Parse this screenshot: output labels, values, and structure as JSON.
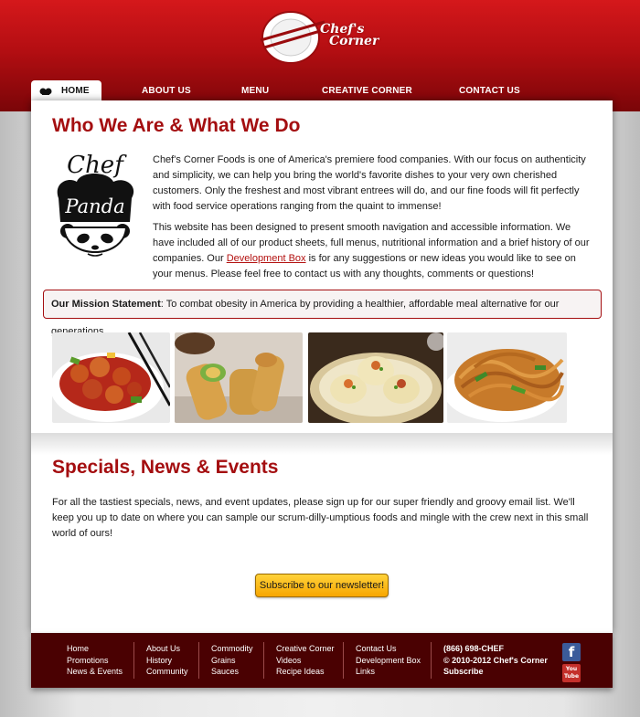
{
  "logo": {
    "line1": "Chef's",
    "line2": "Corner"
  },
  "nav": {
    "items": [
      {
        "label": "HOME",
        "active": true
      },
      {
        "label": "ABOUT US"
      },
      {
        "label": "MENU"
      },
      {
        "label": "CREATIVE CORNER"
      },
      {
        "label": "CONTACT US"
      }
    ]
  },
  "intro": {
    "title": "Who We Are & What We Do",
    "panda_line1": "Chef",
    "panda_line2": "Panda",
    "p1": "Chef's Corner Foods is one of America's premiere food companies. With our focus on authenticity and simplicity, we can help you bring the world's favorite dishes to your very own cherished customers. Only the freshest and most vibrant entrees will do, and our fine foods will fit perfectly with food service operations ranging from the quaint to immense!",
    "p2_before": "This website has been designed to present smooth navigation and accessible information. We have included all of our product sheets, full menus, nutritional information and a brief history of our companies. Our ",
    "p2_link": "Development Box",
    "p2_after": " is for any suggestions or new ideas you would like to see on your menus. Please feel free to contact us with any thoughts, comments or questions!"
  },
  "mission": {
    "label": "Our Mission Statement",
    "text": ": To combat obesity in America by providing a healthier, affordable meal alternative for our generations."
  },
  "photos": [
    {
      "name": "sweet-and-sour-chicken"
    },
    {
      "name": "spring-rolls"
    },
    {
      "name": "dumplings"
    },
    {
      "name": "lo-mein-noodles"
    }
  ],
  "news": {
    "title": "Specials, News & Events",
    "text": "For all the tastiest specials, news, and event updates, please sign up for our super friendly and groovy email list. We'll keep you up to date on where you can sample our scrum-dilly-umptious foods and mingle with the crew next in this small world of ours!",
    "button": "Subscribe to our newsletter!"
  },
  "footer": {
    "col1": [
      "Home",
      "Promotions",
      "News & Events"
    ],
    "col2": [
      "About Us",
      "History",
      "Community"
    ],
    "col3": [
      "Commodity",
      "Grains",
      "Sauces"
    ],
    "col4": [
      "Creative Corner",
      "Videos",
      "Recipe Ideas"
    ],
    "col5": [
      "Contact Us",
      "Development Box",
      "Links"
    ],
    "phone": "(866) 698-CHEF",
    "copyright": "© 2010-2012 Chef's Corner",
    "subscribe": "Subscribe",
    "facebook_icon": "f",
    "youtube_icon": "You Tube"
  },
  "colors": {
    "brand_red": "#a40e10",
    "header_red": "#d5181b",
    "footer_bg": "#4a0102",
    "button_gold": "#f7a600"
  }
}
